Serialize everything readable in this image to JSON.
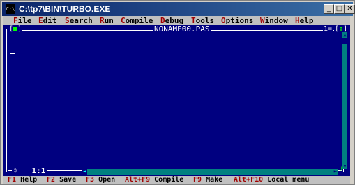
{
  "window": {
    "title": "C:\\tp7\\BIN\\TURBO.EXE",
    "icon_text": "C:\\",
    "minimize_glyph": "_",
    "maximize_glyph": "□",
    "close_glyph": "✕"
  },
  "menu": {
    "items": [
      {
        "hot": "F",
        "rest": "ile"
      },
      {
        "hot": "E",
        "rest": "dit"
      },
      {
        "hot": "S",
        "rest": "earch"
      },
      {
        "hot": "R",
        "rest": "un"
      },
      {
        "hot": "C",
        "rest": "ompile"
      },
      {
        "hot": "D",
        "rest": "ebug"
      },
      {
        "hot": "T",
        "rest": "ools"
      },
      {
        "hot": "O",
        "rest": "ptions"
      },
      {
        "hot": "W",
        "rest": "indow"
      },
      {
        "hot": "H",
        "rest": "elp"
      }
    ]
  },
  "editor": {
    "close_box": {
      "left": "[",
      "mark": "■",
      "right": "]"
    },
    "doc_title": "NONAME00.PAS",
    "window_number": "1=",
    "zoom_box": {
      "left": "[",
      "mark": "↕",
      "right": "]"
    },
    "cursor_position": "1:1",
    "modified_marker": "☼",
    "scroll_up": "▲",
    "scroll_down": "▼",
    "scroll_left": "◄",
    "scroll_right": "►",
    "resize_glyph": "┘"
  },
  "status_bar": {
    "items": [
      {
        "key": "F1",
        "label": "Help"
      },
      {
        "key": "F2",
        "label": "Save"
      },
      {
        "key": "F3",
        "label": "Open"
      },
      {
        "key": "Alt+F9",
        "label": "Compile"
      },
      {
        "key": "F9",
        "label": "Make"
      },
      {
        "key": "Alt+F10",
        "label": "Local menu"
      }
    ]
  },
  "colors": {
    "desktop_blue": "#000080",
    "menu_gray": "#c0c0c0",
    "hotkey_red": "#a00000",
    "scroll_teal": "#008080",
    "accent_green": "#00ff00"
  }
}
